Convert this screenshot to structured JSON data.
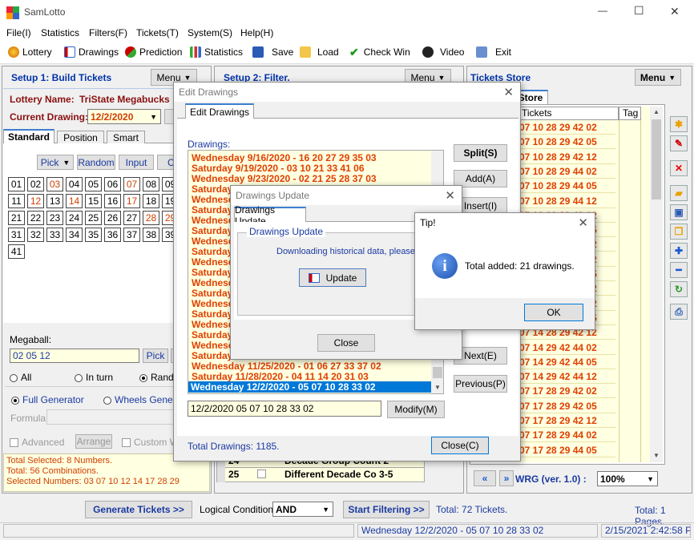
{
  "app": {
    "title": "SamLotto",
    "title_min": "—",
    "title_max": "☐",
    "title_close": "✕"
  },
  "menu": [
    "File(I)",
    "Statistics",
    "Filters(F)",
    "Tickets(T)",
    "System(S)",
    "Help(H)"
  ],
  "toolbar": [
    "Lottery",
    "Drawings",
    "Prediction",
    "Statistics",
    "Save",
    "Load",
    "Check Win",
    "Video",
    "Exit"
  ],
  "setup1": {
    "title": "Setup 1: Build  Tickets",
    "menu": "Menu",
    "lottery_label": "Lottery  Name:",
    "lottery_name": "TriState Megabucks",
    "current_label": "Current Drawing:",
    "current_value": "12/2/2020",
    "tabs": [
      "Standard",
      "Position",
      "Smart"
    ],
    "pick": "Pick",
    "random": "Random",
    "input": "Input",
    "c": "C",
    "numbers": [
      "01",
      "02",
      "03",
      "04",
      "05",
      "06",
      "07",
      "08",
      "09",
      "11",
      "12",
      "13",
      "14",
      "15",
      "16",
      "17",
      "18",
      "19",
      "21",
      "22",
      "23",
      "24",
      "25",
      "26",
      "27",
      "28",
      "29",
      "31",
      "32",
      "33",
      "34",
      "35",
      "36",
      "37",
      "38",
      "39",
      "41"
    ],
    "megaball_label": "Megaball:",
    "megaball_value": "02 05 12",
    "mpick": "Pick",
    "r_all": "All",
    "r_inturn": "In turn",
    "r_rand": "Rand",
    "full_gen": "Full Generator",
    "wheels": "Wheels Genera",
    "formula": "Formula:",
    "advanced": "Advanced",
    "arrange": "Arrange",
    "custom": "Custom W",
    "status": [
      "Total Selected: 8 Numbers.",
      "Total: 56 Combinations.",
      "Selected Numbers: 03 07 10 12 14 17 28 29"
    ]
  },
  "setup2": {
    "title": "Setup 2: Filter.",
    "menu": "Menu",
    "row24_num": "24",
    "row24_label": "Decade Group Count 2",
    "row25_num": "25",
    "row25_label": "Different Decade Co 3-5"
  },
  "store": {
    "title": "Tickets Store",
    "menu": "Menu",
    "tab": "Store",
    "col_tickets": "Tickets",
    "col_tag": "Tag",
    "rows": [
      "07 10 28 29 42 02",
      "07 10 28 29 42 05",
      "07 10 28 29 42 12",
      "07 10 28 29 44 02",
      "07 10 28 29 44 05",
      "07 10 28 29 44 12",
      "07 12 28 29 42 02",
      "07 12 28 29 42 05",
      "07 12 28 29 42 12",
      "07 12 28 29 44 02",
      "07 12 28 29 44 05",
      "07 12 28 29 44 12",
      "07 14 28 29 42 02",
      "07 14 28 29 42 05",
      "07 14 28 29 42 12",
      "07 14 29 42 44 02",
      "07 14 29 42 44 05",
      "07 14 29 42 44 12",
      "07 17 28 29 42 02",
      "07 17 28 29 42 05",
      "07 17 28 29 42 12",
      "07 17 28 29 44 02",
      "07 17 28 29 44 05"
    ],
    "wrg": "WRG (ver. 1.0) :",
    "zoom": "100%"
  },
  "bottom": {
    "generate": "Generate Tickets >>",
    "logical": "Logical Condition:",
    "and": "AND",
    "start": "Start Filtering >>",
    "total_tickets": "Total: 72 Tickets.",
    "total_pages": "Total: 1 Pages.",
    "status_mid": "Wednesday 12/2/2020 - 05 07 10 28 33 02",
    "status_right": "2/15/2021 2:42:58 PM"
  },
  "edit": {
    "title": "Edit Drawings",
    "tab": "Edit Drawings",
    "drawings_label": "Drawings:",
    "lines_top": [
      "Wednesday 9/16/2020 - 16 20 27 29 35 03",
      "Saturday 9/19/2020 - 03 10 21 33 41 06",
      "Wednesday 9/23/2020 - 02 21 25 28 37 03"
    ],
    "lines_mid": [
      "Saturday",
      "Wednesd",
      "Saturday",
      "Wednesd",
      "Saturday",
      "Wednesd",
      "Saturday",
      "Wednesd",
      "Saturday",
      "Wednesd",
      "Saturday",
      "Wednesd",
      "Saturday",
      "Wednesd",
      "Saturday",
      "Wednesd",
      "Saturday"
    ],
    "lines_bottom": [
      "Wednesday 11/25/2020 - 01 06 27 33 37 02",
      "Saturday 11/28/2020 - 04 11 14 20 31 03"
    ],
    "selected": "Wednesday 12/2/2020 - 05 07 10 28 33 02",
    "input_value": "12/2/2020 05 07 10 28 33 02",
    "modify": "Modify(M)",
    "total": "Total Drawings: 1185.",
    "close": "Close(C)",
    "split": "Split(S)",
    "add": "Add(A)",
    "insert": "Insert(I)",
    "next": "Next(E)",
    "previous": "Previous(P)"
  },
  "update": {
    "title": "Drawings Update",
    "tab": "Drawings Update",
    "group": "Drawings Update",
    "text": "Downloading historical data, please w",
    "update_btn": "Update",
    "close": "Close"
  },
  "tip": {
    "title": "Tip!",
    "message": "Total added: 21 drawings.",
    "ok": "OK",
    "info_glyph": "i"
  },
  "colors": {
    "accent_blue": "#0033aa",
    "red_text": "#e04000",
    "yellow_bg": "#ffffe1",
    "selection": "#0078d7"
  }
}
